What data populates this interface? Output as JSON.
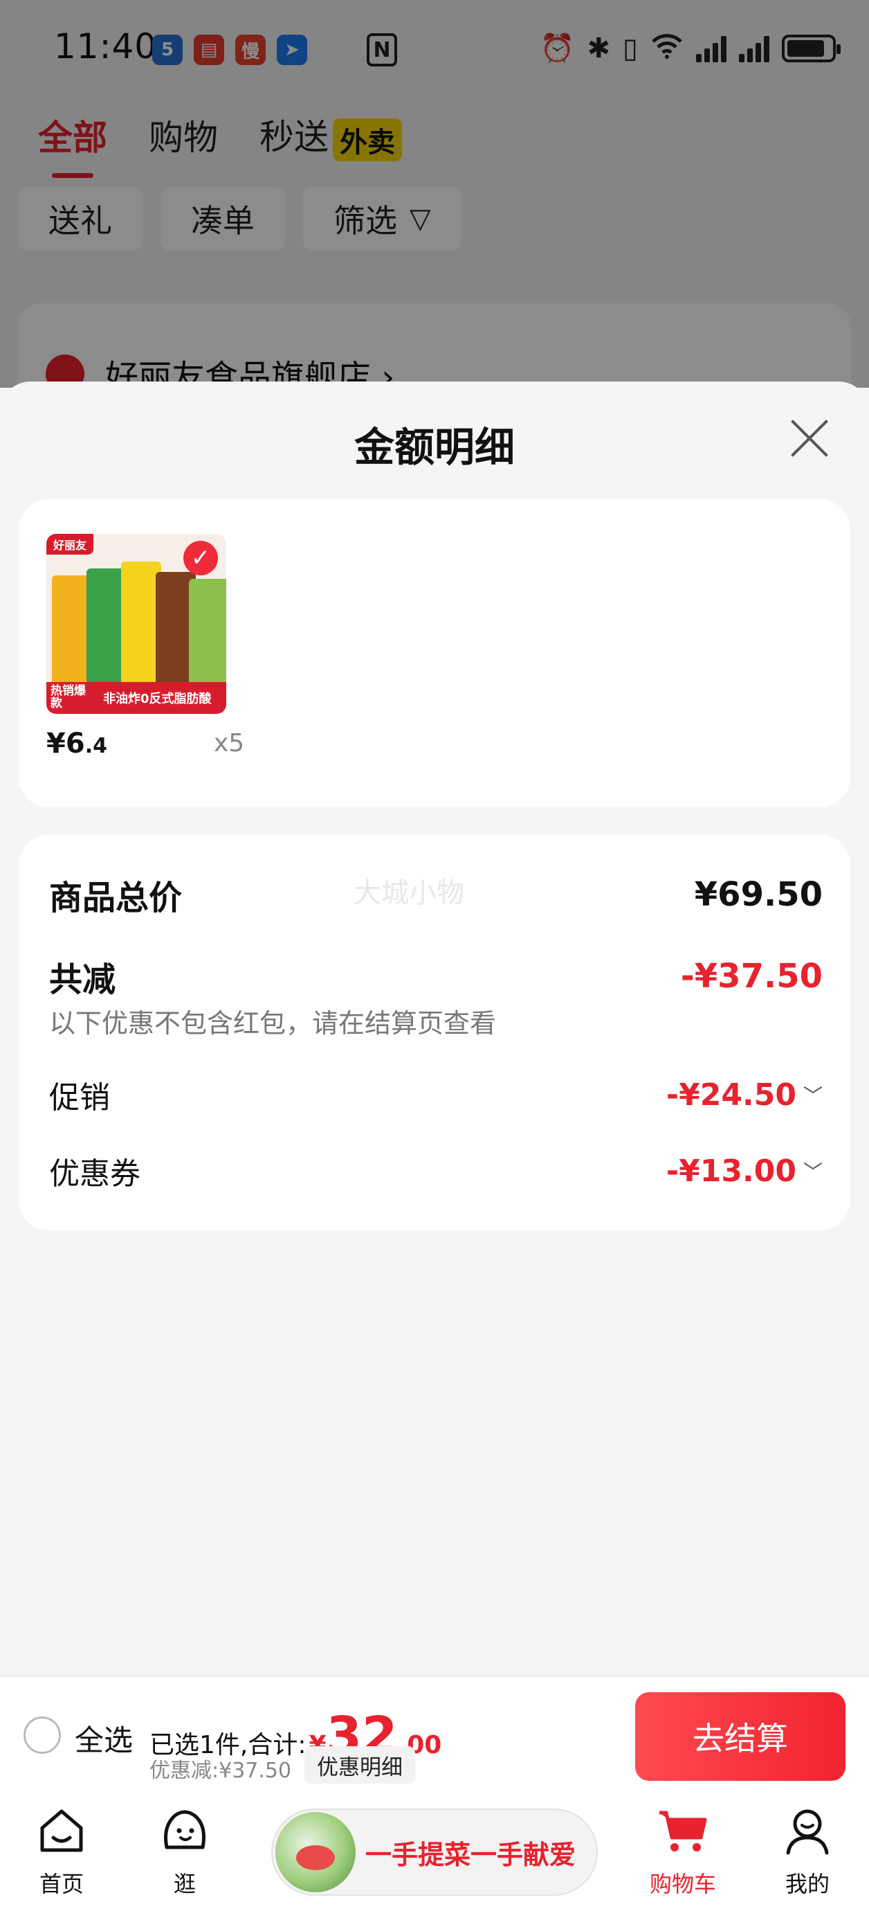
{
  "status_bar": {
    "time": "11:40",
    "app_icons": [
      {
        "name": "app-5-icon",
        "glyph": "5",
        "color": "#2a6fd6"
      },
      {
        "name": "book-app-icon",
        "glyph": "▤",
        "color": "#e5392f"
      },
      {
        "name": "slow-app-icon",
        "glyph": "慢",
        "color": "#e8422a"
      },
      {
        "name": "send-app-icon",
        "glyph": "➤",
        "color": "#1d7bf0"
      }
    ],
    "nfc_glyph": "N"
  },
  "top_tabs": [
    {
      "label": "全部",
      "active": true
    },
    {
      "label": "购物",
      "active": false
    },
    {
      "label": "秒送",
      "active": false,
      "badge": "外卖"
    }
  ],
  "filters": [
    "送礼",
    "凑单",
    "筛选"
  ],
  "background_shop": "好丽友食品旗舰店 ›",
  "sheet": {
    "title": "金额明细",
    "product": {
      "brand_tag": "好丽友",
      "hot_tag": "热销爆款",
      "tag_line": "非油炸0反式脂肪酸",
      "price_symbol": "¥",
      "price_int": "6",
      "price_dec": ".4",
      "quantity": "x5"
    },
    "watermark": "大城小物",
    "summary": {
      "total_label": "商品总价",
      "total_value": "¥69.50",
      "reduce_label": "共减",
      "reduce_value": "-¥37.50",
      "note": "以下优惠不包含红包，请在结算页查看",
      "items": [
        {
          "label": "促销",
          "value": "-¥24.50"
        },
        {
          "label": "优惠券",
          "value": "-¥13.00"
        }
      ]
    }
  },
  "checkout": {
    "select_all": "全选",
    "selected_text": "已选1件,合计:",
    "total_symbol": "¥",
    "total_int": "32",
    "total_dec": ".00",
    "discount_text": "优惠减:¥37.50",
    "detail_button": "优惠明细",
    "checkout_button": "去结算"
  },
  "tabbar": {
    "items": [
      {
        "label": "首页",
        "icon": "home-icon",
        "active": false
      },
      {
        "label": "逛",
        "icon": "browse-icon",
        "active": false
      },
      {
        "label": "购物车",
        "icon": "cart-icon",
        "active": true
      },
      {
        "label": "我的",
        "icon": "profile-icon",
        "active": false
      }
    ],
    "promo_text": "一手提菜一手献爱"
  },
  "colors": {
    "accent": "#e8222e",
    "background": "#f5f5f5",
    "card": "#ffffff"
  }
}
